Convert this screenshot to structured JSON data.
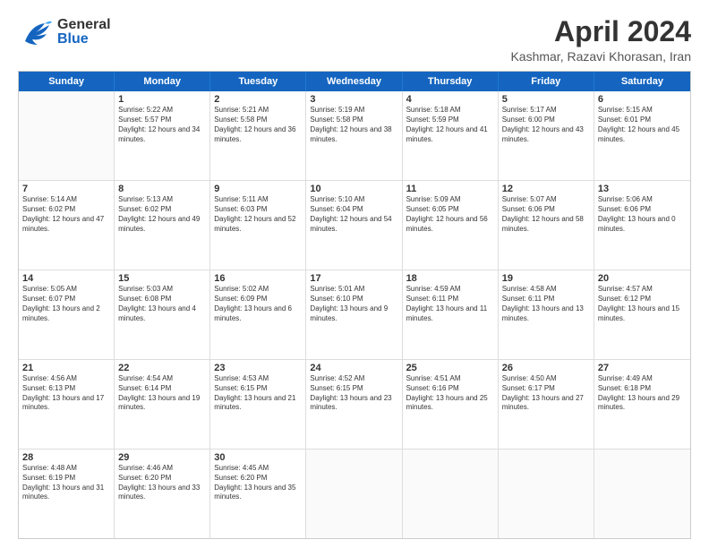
{
  "header": {
    "logo": {
      "general": "General",
      "blue": "Blue"
    },
    "title": "April 2024",
    "subtitle": "Kashmar, Razavi Khorasan, Iran"
  },
  "calendar": {
    "days": [
      "Sunday",
      "Monday",
      "Tuesday",
      "Wednesday",
      "Thursday",
      "Friday",
      "Saturday"
    ],
    "rows": [
      [
        {
          "day": "",
          "empty": true
        },
        {
          "day": "1",
          "sunrise": "Sunrise: 5:22 AM",
          "sunset": "Sunset: 5:57 PM",
          "daylight": "Daylight: 12 hours and 34 minutes."
        },
        {
          "day": "2",
          "sunrise": "Sunrise: 5:21 AM",
          "sunset": "Sunset: 5:58 PM",
          "daylight": "Daylight: 12 hours and 36 minutes."
        },
        {
          "day": "3",
          "sunrise": "Sunrise: 5:19 AM",
          "sunset": "Sunset: 5:58 PM",
          "daylight": "Daylight: 12 hours and 38 minutes."
        },
        {
          "day": "4",
          "sunrise": "Sunrise: 5:18 AM",
          "sunset": "Sunset: 5:59 PM",
          "daylight": "Daylight: 12 hours and 41 minutes."
        },
        {
          "day": "5",
          "sunrise": "Sunrise: 5:17 AM",
          "sunset": "Sunset: 6:00 PM",
          "daylight": "Daylight: 12 hours and 43 minutes."
        },
        {
          "day": "6",
          "sunrise": "Sunrise: 5:15 AM",
          "sunset": "Sunset: 6:01 PM",
          "daylight": "Daylight: 12 hours and 45 minutes."
        }
      ],
      [
        {
          "day": "7",
          "sunrise": "Sunrise: 5:14 AM",
          "sunset": "Sunset: 6:02 PM",
          "daylight": "Daylight: 12 hours and 47 minutes."
        },
        {
          "day": "8",
          "sunrise": "Sunrise: 5:13 AM",
          "sunset": "Sunset: 6:02 PM",
          "daylight": "Daylight: 12 hours and 49 minutes."
        },
        {
          "day": "9",
          "sunrise": "Sunrise: 5:11 AM",
          "sunset": "Sunset: 6:03 PM",
          "daylight": "Daylight: 12 hours and 52 minutes."
        },
        {
          "day": "10",
          "sunrise": "Sunrise: 5:10 AM",
          "sunset": "Sunset: 6:04 PM",
          "daylight": "Daylight: 12 hours and 54 minutes."
        },
        {
          "day": "11",
          "sunrise": "Sunrise: 5:09 AM",
          "sunset": "Sunset: 6:05 PM",
          "daylight": "Daylight: 12 hours and 56 minutes."
        },
        {
          "day": "12",
          "sunrise": "Sunrise: 5:07 AM",
          "sunset": "Sunset: 6:06 PM",
          "daylight": "Daylight: 12 hours and 58 minutes."
        },
        {
          "day": "13",
          "sunrise": "Sunrise: 5:06 AM",
          "sunset": "Sunset: 6:06 PM",
          "daylight": "Daylight: 13 hours and 0 minutes."
        }
      ],
      [
        {
          "day": "14",
          "sunrise": "Sunrise: 5:05 AM",
          "sunset": "Sunset: 6:07 PM",
          "daylight": "Daylight: 13 hours and 2 minutes."
        },
        {
          "day": "15",
          "sunrise": "Sunrise: 5:03 AM",
          "sunset": "Sunset: 6:08 PM",
          "daylight": "Daylight: 13 hours and 4 minutes."
        },
        {
          "day": "16",
          "sunrise": "Sunrise: 5:02 AM",
          "sunset": "Sunset: 6:09 PM",
          "daylight": "Daylight: 13 hours and 6 minutes."
        },
        {
          "day": "17",
          "sunrise": "Sunrise: 5:01 AM",
          "sunset": "Sunset: 6:10 PM",
          "daylight": "Daylight: 13 hours and 9 minutes."
        },
        {
          "day": "18",
          "sunrise": "Sunrise: 4:59 AM",
          "sunset": "Sunset: 6:11 PM",
          "daylight": "Daylight: 13 hours and 11 minutes."
        },
        {
          "day": "19",
          "sunrise": "Sunrise: 4:58 AM",
          "sunset": "Sunset: 6:11 PM",
          "daylight": "Daylight: 13 hours and 13 minutes."
        },
        {
          "day": "20",
          "sunrise": "Sunrise: 4:57 AM",
          "sunset": "Sunset: 6:12 PM",
          "daylight": "Daylight: 13 hours and 15 minutes."
        }
      ],
      [
        {
          "day": "21",
          "sunrise": "Sunrise: 4:56 AM",
          "sunset": "Sunset: 6:13 PM",
          "daylight": "Daylight: 13 hours and 17 minutes."
        },
        {
          "day": "22",
          "sunrise": "Sunrise: 4:54 AM",
          "sunset": "Sunset: 6:14 PM",
          "daylight": "Daylight: 13 hours and 19 minutes."
        },
        {
          "day": "23",
          "sunrise": "Sunrise: 4:53 AM",
          "sunset": "Sunset: 6:15 PM",
          "daylight": "Daylight: 13 hours and 21 minutes."
        },
        {
          "day": "24",
          "sunrise": "Sunrise: 4:52 AM",
          "sunset": "Sunset: 6:15 PM",
          "daylight": "Daylight: 13 hours and 23 minutes."
        },
        {
          "day": "25",
          "sunrise": "Sunrise: 4:51 AM",
          "sunset": "Sunset: 6:16 PM",
          "daylight": "Daylight: 13 hours and 25 minutes."
        },
        {
          "day": "26",
          "sunrise": "Sunrise: 4:50 AM",
          "sunset": "Sunset: 6:17 PM",
          "daylight": "Daylight: 13 hours and 27 minutes."
        },
        {
          "day": "27",
          "sunrise": "Sunrise: 4:49 AM",
          "sunset": "Sunset: 6:18 PM",
          "daylight": "Daylight: 13 hours and 29 minutes."
        }
      ],
      [
        {
          "day": "28",
          "sunrise": "Sunrise: 4:48 AM",
          "sunset": "Sunset: 6:19 PM",
          "daylight": "Daylight: 13 hours and 31 minutes."
        },
        {
          "day": "29",
          "sunrise": "Sunrise: 4:46 AM",
          "sunset": "Sunset: 6:20 PM",
          "daylight": "Daylight: 13 hours and 33 minutes."
        },
        {
          "day": "30",
          "sunrise": "Sunrise: 4:45 AM",
          "sunset": "Sunset: 6:20 PM",
          "daylight": "Daylight: 13 hours and 35 minutes."
        },
        {
          "day": "",
          "empty": true
        },
        {
          "day": "",
          "empty": true
        },
        {
          "day": "",
          "empty": true
        },
        {
          "day": "",
          "empty": true
        }
      ]
    ]
  }
}
